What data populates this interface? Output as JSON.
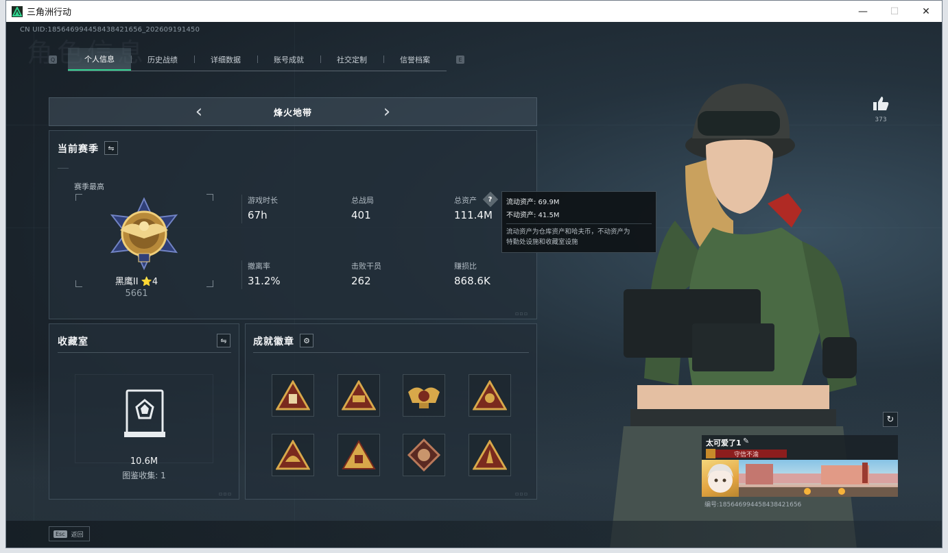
{
  "window": {
    "title": "三角洲行动",
    "minimize": "—",
    "maximize": "☐",
    "close": "✕"
  },
  "uid": "CN UID:185646994458438421656_202609191450",
  "background_title": "角色信息",
  "key_hints": {
    "left": "Q",
    "right": "E"
  },
  "tabs": [
    {
      "label": "个人信息",
      "active": true
    },
    {
      "label": "历史战绩",
      "active": false
    },
    {
      "label": "详细数据",
      "active": false
    },
    {
      "label": "账号成就",
      "active": false
    },
    {
      "label": "社交定制",
      "active": false
    },
    {
      "label": "信誉档案",
      "active": false
    }
  ],
  "mode": {
    "name": "烽火地带",
    "prev": "‹",
    "next": "›"
  },
  "season": {
    "title": "当前赛季",
    "swap_icon": "⇋",
    "highest_label": "赛季最高",
    "rank_name": "黑鹰II ⭐4",
    "rank_score": "5661",
    "stats": [
      {
        "label": "游戏时长",
        "value": "67h"
      },
      {
        "label": "总战局",
        "value": "401"
      },
      {
        "label": "总资产",
        "value": "111.4M"
      },
      {
        "label": "撤离率",
        "value": "31.2%"
      },
      {
        "label": "击败干员",
        "value": "262"
      },
      {
        "label": "赚损比",
        "value": "868.6K"
      }
    ],
    "help_icon": "?"
  },
  "tooltip": {
    "liquid": "流动资产: 69.9M",
    "fixed": "不动资产: 41.5M",
    "desc_line1": "流动资产为仓库资产和哈夫币，不动资产为",
    "desc_line2": "特勤处设施和收藏室设施"
  },
  "collection": {
    "title": "收藏室",
    "swap_icon": "⇋",
    "value": "10.6M",
    "count": "图鉴收集: 1"
  },
  "achievements": {
    "title": "成就徽章",
    "gear_icon": "⚙",
    "badges": [
      "badge-1",
      "badge-2",
      "badge-3",
      "badge-4",
      "badge-5",
      "badge-6",
      "badge-7",
      "badge-8"
    ]
  },
  "like": {
    "count": "373"
  },
  "refresh_icon": "↻",
  "player": {
    "name": "太可爱了1",
    "edit_icon": "✎",
    "honor": "守信不渝",
    "id": "编号:1856469944584384216​56"
  },
  "esc": {
    "key": "Esc",
    "label": "返回"
  },
  "colors": {
    "accent": "#2fd38e",
    "panel": "#232e38",
    "honor": "#8c1d1d",
    "gold": "#c9a04a"
  }
}
